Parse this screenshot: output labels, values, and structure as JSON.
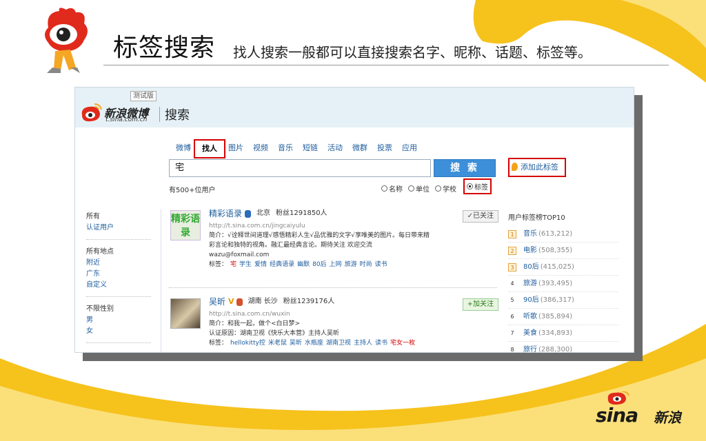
{
  "slide": {
    "title": "标签搜索",
    "subtitle": "找人搜索一般都可以直接搜索名字、昵称、话题、标签等。",
    "brand_cn": "新浪",
    "brand_en": "sina"
  },
  "weibo": {
    "beta_badge": "测试版",
    "logo_cn": "新浪微博",
    "logo_url": "t.sina.com.cn",
    "page_heading": "搜索",
    "tabs": [
      "微博",
      "找人",
      "图片",
      "视频",
      "音乐",
      "短链",
      "活动",
      "微群",
      "投票",
      "应用"
    ],
    "active_tab": "找人",
    "search": {
      "value": "宅",
      "button": "搜 索"
    },
    "add_tag": "添加此标签",
    "result_count": "有500+位用户",
    "radio_options": [
      {
        "label": "名称",
        "checked": false
      },
      {
        "label": "单位",
        "checked": false
      },
      {
        "label": "学校",
        "checked": false
      },
      {
        "label": "标签",
        "checked": true
      }
    ],
    "filters": [
      {
        "items": [
          "所有",
          "认证用户"
        ]
      },
      {
        "items": [
          "所有地点",
          "附近",
          "广东",
          "自定义"
        ]
      },
      {
        "items": [
          "不限性别",
          "男",
          "女"
        ]
      }
    ],
    "results": [
      {
        "avatar_text": "精彩语录",
        "name": "精彩语录",
        "location": "北京",
        "fans": "粉丝1291850人",
        "url": "http://t.sina.com.cn/jingcaiyulu",
        "intro1": "简介：√诠释世间道理√感悟精彩人生√品优雅的文字√享唯美的图片。每日带来精",
        "intro2": "彩言论和独特的视角。融汇最经典言论。期待关注 欢迎交流",
        "extra": "wazu@foxmail.com",
        "tag_label": "标签：",
        "tags": [
          "宅",
          "学生",
          "爱情",
          "经典语录",
          "幽默",
          "80后",
          "上网",
          "旅游",
          "时尚",
          "读书"
        ],
        "follow": "✓已关注"
      },
      {
        "name": "吴昕",
        "verified": "V",
        "location": "湖南 长沙",
        "fans": "粉丝1239176人",
        "url": "http://t.sina.com.cn/wuxin",
        "intro1": "简介：和我一起，做个<白日梦>",
        "intro2": "认证原因：湖南卫视《快乐大本营》主持人吴昕",
        "tag_label": "标签：",
        "tags": [
          "hellokitty控",
          "米老鼠",
          "吴昕",
          "水瓶座",
          "湖南卫视",
          "主持人",
          "读书",
          "宅女一枚"
        ],
        "follow": "+加关注"
      }
    ],
    "top10": {
      "title": "用户标签榜TOP10",
      "rows": [
        {
          "rank": "1",
          "name": "音乐",
          "count": "(613,212)"
        },
        {
          "rank": "2",
          "name": "电影",
          "count": "(508,355)"
        },
        {
          "rank": "3",
          "name": "80后",
          "count": "(415,025)"
        },
        {
          "rank": "4",
          "name": "旅游",
          "count": "(393,495)"
        },
        {
          "rank": "5",
          "name": "90后",
          "count": "(386,317)"
        },
        {
          "rank": "6",
          "name": "听歌",
          "count": "(385,894)"
        },
        {
          "rank": "7",
          "name": "美食",
          "count": "(334,893)"
        },
        {
          "rank": "8",
          "name": "旅行",
          "count": "(288,300)"
        }
      ]
    }
  },
  "colors": {
    "accent_yellow": "#f6c21c",
    "highlight_red": "#d40000",
    "link_blue": "#1d5c9c",
    "button_blue": "#3c8fd8"
  }
}
